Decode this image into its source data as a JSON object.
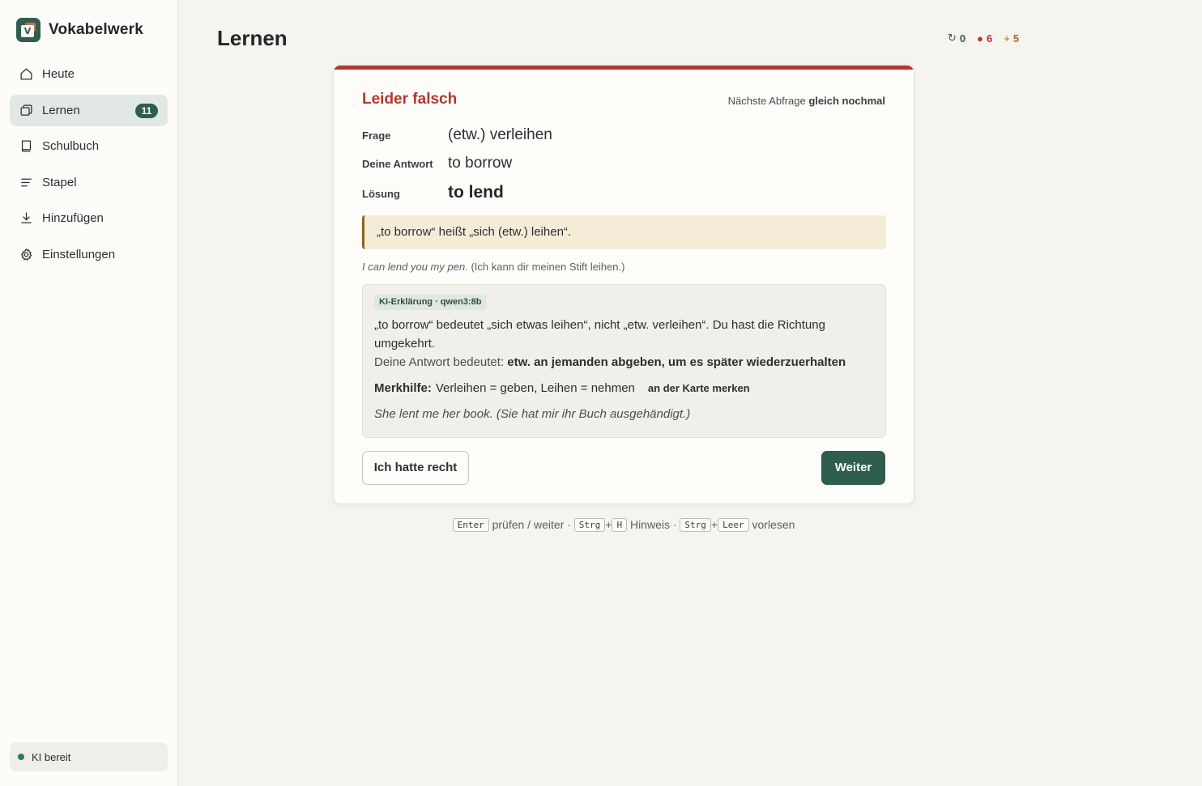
{
  "app": {
    "name": "Vokabelwerk",
    "logo_letter": "V"
  },
  "nav": {
    "items": [
      {
        "label": "Heute",
        "icon": "home-icon"
      },
      {
        "label": "Lernen",
        "icon": "cards-icon",
        "badge": "11",
        "active": true
      },
      {
        "label": "Schulbuch",
        "icon": "book-icon"
      },
      {
        "label": "Stapel",
        "icon": "list-icon"
      },
      {
        "label": "Hinzufügen",
        "icon": "download-icon"
      },
      {
        "label": "Einstellungen",
        "icon": "gear-icon"
      }
    ]
  },
  "ki_status": "KI bereit",
  "page": {
    "title": "Lernen"
  },
  "stats": {
    "review": {
      "symbol": "↻",
      "value": "0"
    },
    "wrong": {
      "symbol": "●",
      "value": "6"
    },
    "new": {
      "symbol": "+",
      "value": "5"
    }
  },
  "result": {
    "title": "Leider falsch",
    "next_prefix": "Nächste Abfrage",
    "next_value": "gleich nochmal"
  },
  "qa": {
    "question_label": "Frage",
    "question": "(etw.) verleihen",
    "answer_label": "Deine Antwort",
    "answer": "to borrow",
    "solution_label": "Lösung",
    "solution": "to lend"
  },
  "hint": "„to borrow“ heißt „sich (etw.) leihen“.",
  "example": {
    "en": "I can lend you my pen.",
    "de": "(Ich kann dir meinen Stift leihen.)"
  },
  "ai": {
    "tag": "KI-Erklärung · qwen3:8b",
    "explanation": "„to borrow“ bedeutet „sich etwas leihen“, nicht „etw. verleihen“. Du hast die Richtung umgekehrt.",
    "meaning_prefix": "Deine Antwort bedeutet:",
    "meaning": "etw. an jemanden abgeben, um es später wiederzuerhalten",
    "mnemonic_label": "Merkhilfe:",
    "mnemonic": "Verleihen = geben, Leihen = nehmen",
    "remember_link": "an der Karte merken",
    "example": "She lent me her book. (Sie hat mir ihr Buch ausgehändigt.)"
  },
  "buttons": {
    "claim_correct": "Ich hatte recht",
    "next": "Weiter"
  },
  "shortcuts": {
    "enter_key": "Enter",
    "enter_action": "prüfen / weiter ·",
    "ctrl_key": "Strg",
    "plus": "+",
    "h_key": "H",
    "hint_action": "Hinweis ·",
    "space_key": "Leer",
    "read_action": "vorlesen"
  },
  "colors": {
    "accent": "#2f5e4e",
    "error": "#b3372f",
    "warning": "#a5681d",
    "hint_bg": "#f5ecd8"
  }
}
